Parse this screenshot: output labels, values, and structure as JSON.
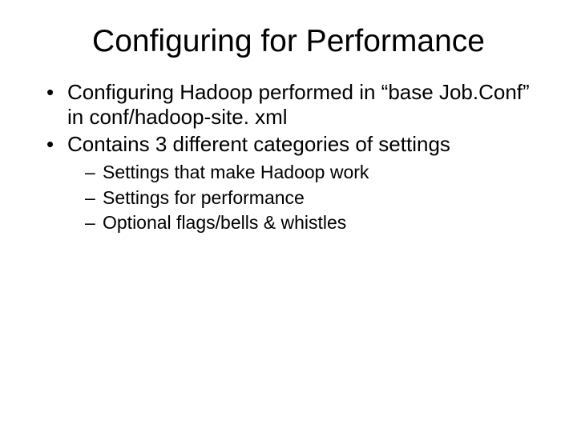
{
  "slide": {
    "title": "Configuring for Performance",
    "bullets": [
      {
        "text": "Configuring Hadoop performed in “base Job.Conf” in conf/hadoop-site. xml"
      },
      {
        "text": "Contains 3 different categories of settings",
        "sub": [
          "Settings that make Hadoop work",
          "Settings for performance",
          "Optional flags/bells & whistles"
        ]
      }
    ]
  }
}
